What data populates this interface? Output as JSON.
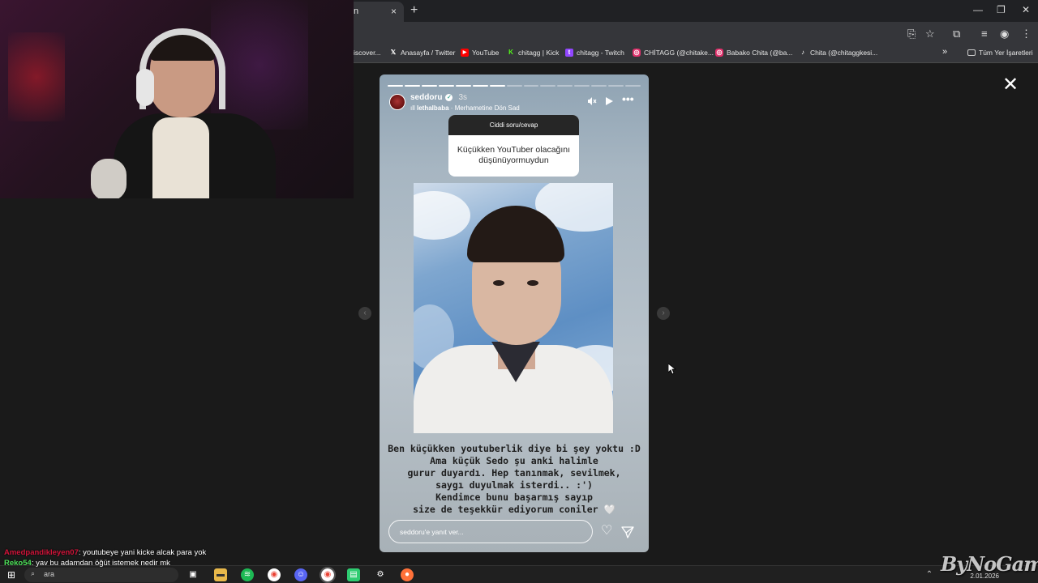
{
  "browser": {
    "tab": {
      "title": "n",
      "close": "×"
    },
    "new_tab": "+",
    "window_controls": {
      "minimize": "—",
      "restore": "❐",
      "close": "✕"
    }
  },
  "bookmarks": [
    {
      "label": "iscover...",
      "icon": "discover-icon",
      "color": "#888888"
    },
    {
      "label": "Anasayfa / Twitter",
      "icon": "x-twitter-icon",
      "color": "#ffffff"
    },
    {
      "label": "YouTube",
      "icon": "youtube-icon",
      "color": "#ff0000"
    },
    {
      "label": "chitagg | Kick",
      "icon": "kick-icon",
      "color": "#53fc18"
    },
    {
      "label": "chitagg - Twitch",
      "icon": "twitch-icon",
      "color": "#9146ff"
    },
    {
      "label": "CHİTAGG (@chitake...",
      "icon": "instagram-icon",
      "color": "#e1306c"
    },
    {
      "label": "Babako Chita (@ba...",
      "icon": "instagram-icon",
      "color": "#e1306c"
    },
    {
      "label": "Chita (@chitaggkesi...",
      "icon": "tiktok-icon",
      "color": "#ffffff"
    }
  ],
  "bookmarks_overflow": "»",
  "all_bookmarks": "Tüm Yer İşaretleri",
  "story": {
    "progress_total": 15,
    "progress_done": 7,
    "username": "seddoru",
    "time": "3s",
    "music_artist": "lethalbaba",
    "music_title": "Merhametine Dön Sad",
    "question_header": "Ciddi soru/cevap",
    "question_text": "Küçükken YouTuber olacağını düşünüyormuydun",
    "caption_lines": [
      "Ben küçükken youtuberlik diye bi şey yoktu :D",
      "Ama küçük Sedo şu anki halimle",
      "gurur duyardı. Hep tanınmak, sevilmek,",
      "saygı duyulmak isterdi.. :')",
      "Kendimce bunu başarmış sayıp",
      "size de teşekkür ediyorum coniler 🤍"
    ],
    "reply_placeholder": "seddoru'e yanıt ver..."
  },
  "chat": [
    {
      "user": "Amedpandikleyen07",
      "color": "#d2143a",
      "message": "youtubeye yani kicke alcak para yok"
    },
    {
      "user": "Reko54",
      "color": "#4ee05a",
      "message": "yav bu adamdan öğüt istemek nedir mk"
    }
  ],
  "taskbar": {
    "search_text": "ara",
    "clock_date": "2.01.2026"
  },
  "watermark": "ByNoGame"
}
